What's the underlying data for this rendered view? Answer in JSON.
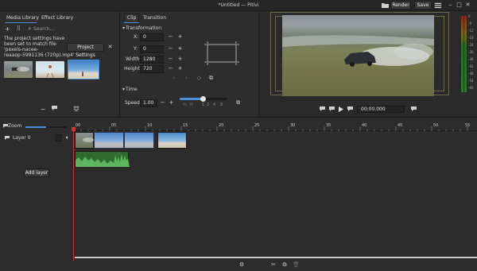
{
  "window": {
    "title": "*Untitled — Pitivi",
    "render_label": "Render",
    "save_label": "Save"
  },
  "media_library": {
    "tabs": [
      "Media Library",
      "Effect Library"
    ],
    "search_placeholder": "Search...",
    "notice_lines": [
      "The project settings have",
      "been set to match file",
      "'pexels-nacee-",
      "reaaop-5991136 (720p).mp4'"
    ],
    "project_settings_label": "Project Settings",
    "close_glyph": "✕"
  },
  "clip_panel": {
    "tabs": [
      "Clip",
      "Transition"
    ],
    "transformation_heading": "Transformation",
    "fields": [
      {
        "label": "X:",
        "value": "0"
      },
      {
        "label": "Y:",
        "value": "0"
      },
      {
        "label": "Width:",
        "value": "1280"
      },
      {
        "label": "Height:",
        "value": "720"
      }
    ],
    "time_heading": "Time",
    "speed_label": "Speed:",
    "speed_value": "1.00",
    "speed_ticks": [
      "¼",
      "½",
      "1",
      "2",
      "4",
      "8"
    ],
    "minus": "−",
    "plus": "+"
  },
  "viewer": {
    "timecode": "00:00.000"
  },
  "timeline": {
    "zoom_label": "Zoom",
    "layer_label": "Layer 0",
    "add_layer_label": "Add layer",
    "ruler_labels": [
      "00",
      "05",
      "10",
      "15",
      "20",
      "25",
      "30",
      "35",
      "40",
      "45",
      "50",
      "55"
    ]
  },
  "meter": {
    "labels": [
      "0",
      "-6",
      "-12",
      "-18",
      "-24",
      "-30",
      "-36",
      "-42",
      "-48",
      "-54",
      "-60"
    ]
  }
}
